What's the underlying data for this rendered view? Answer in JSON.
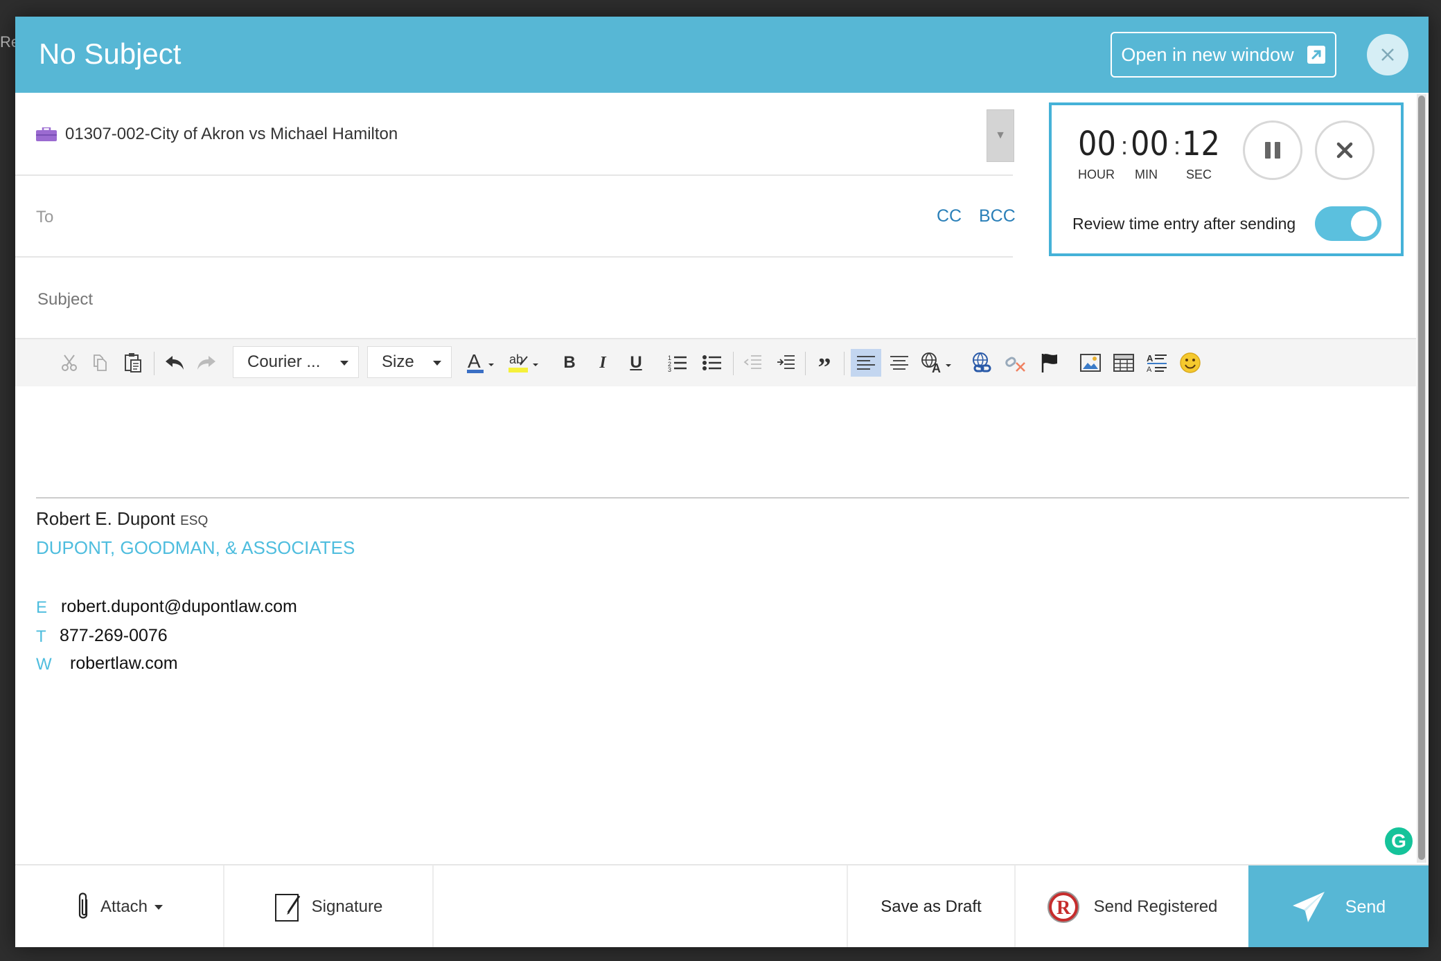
{
  "backdrop": {
    "text": "Re"
  },
  "header": {
    "title": "No Subject",
    "open_label": "Open in new window"
  },
  "matter": {
    "label": "01307-002-City of Akron vs Michael Hamilton"
  },
  "recipients": {
    "to_label": "To",
    "cc_label": "CC",
    "bcc_label": "BCC"
  },
  "timer": {
    "hours": "00",
    "minutes": "00",
    "seconds": "12",
    "hour_label": "HOUR",
    "min_label": "MIN",
    "sec_label": "SEC",
    "review_label": "Review time entry after sending",
    "review_enabled": true
  },
  "subject": {
    "placeholder": "Subject",
    "value": ""
  },
  "toolbar": {
    "font_value": "Courier ...",
    "size_value": "Size"
  },
  "signature": {
    "name": "Robert E. Dupont",
    "suffix": "ESQ",
    "firm": "DUPONT, GOODMAN, & ASSOCIATES",
    "email_label": "E",
    "email": "robert.dupont@dupontlaw.com",
    "phone_label": "T",
    "phone": "877-269-0076",
    "web_label": "W",
    "web": "robertlaw.com"
  },
  "grammarly": {
    "letter": "G"
  },
  "footer": {
    "attach_label": "Attach",
    "signature_label": "Signature",
    "save_draft_label": "Save as Draft",
    "send_registered_label": "Send Registered",
    "send_label": "Send"
  },
  "colors": {
    "header": "#57b7d5",
    "accent": "#45b2d8",
    "firm": "#4ebdde",
    "link": "#2a7fb8"
  }
}
